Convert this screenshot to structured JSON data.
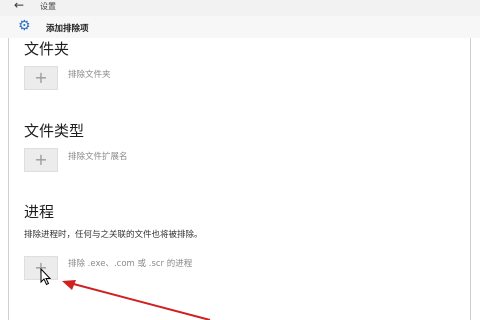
{
  "titlebar": {
    "back_icon": "back-arrow-icon",
    "title": "设置"
  },
  "header": {
    "icon": "gear-icon",
    "title": "添加排除项",
    "accent": "#2b6fc2"
  },
  "sections": {
    "folder": {
      "title": "文件夹",
      "add_label": "排除文件夹"
    },
    "filetype": {
      "title": "文件类型",
      "add_label": "排除文件扩展名"
    },
    "process": {
      "title": "进程",
      "description": "排除进程时，任何与之关联的文件也将被排除。",
      "add_label": "排除 .exe、.com 或 .scr 的进程"
    }
  },
  "annotation": {
    "color": "#d02020"
  }
}
